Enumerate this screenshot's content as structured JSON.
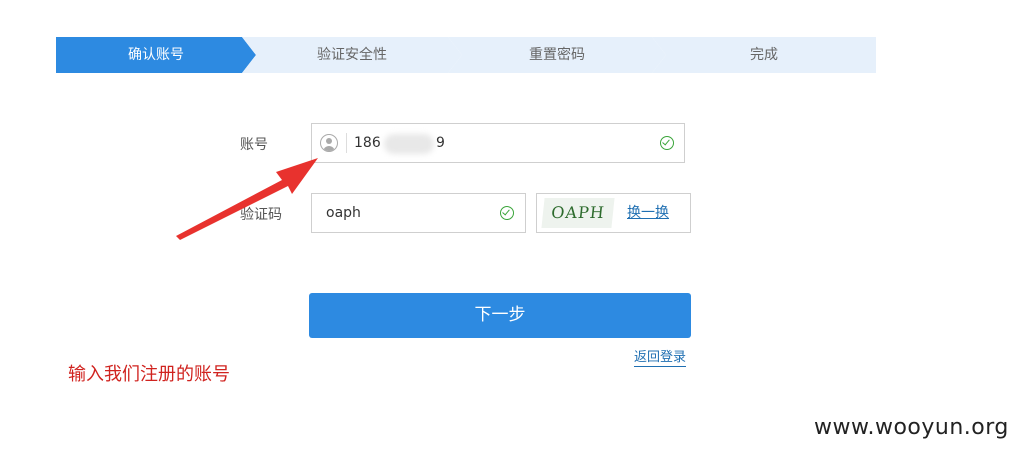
{
  "steps": [
    {
      "label": "确认账号",
      "active": true
    },
    {
      "label": "验证安全性",
      "active": false
    },
    {
      "label": "重置密码",
      "active": false
    },
    {
      "label": "完成",
      "active": false
    }
  ],
  "form": {
    "account_label": "账号",
    "account_value_prefix": "186",
    "account_value_suffix": "9",
    "captcha_label": "验证码",
    "captcha_value": "oaph",
    "captcha_image_text": "OAPH",
    "refresh_label": "换一换",
    "next_button": "下一步",
    "back_login": "返回登录"
  },
  "annotation": "输入我们注册的账号",
  "watermark": "www.wooyun.org",
  "colors": {
    "primary": "#2d8ae1",
    "step_bg": "#e6f0fb",
    "valid": "#3aa53a",
    "annotation": "#d0231f",
    "link": "#1f6fb2"
  }
}
